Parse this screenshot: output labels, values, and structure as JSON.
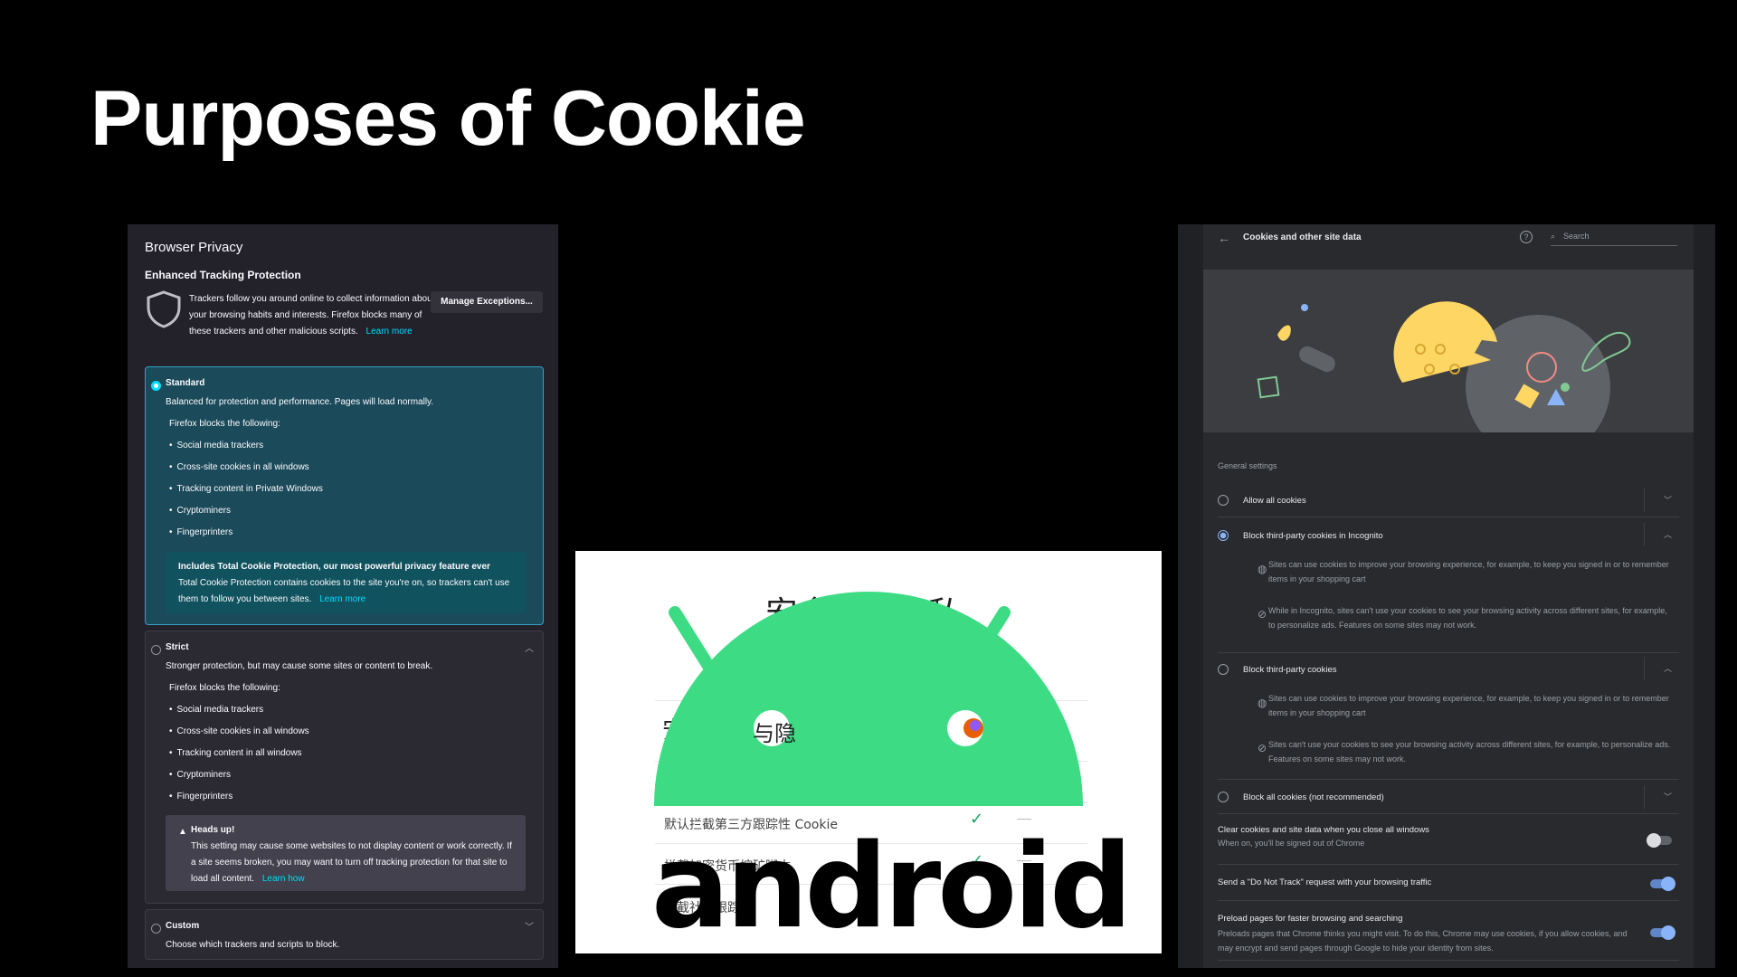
{
  "slide": {
    "title": "Purposes of Cookie"
  },
  "firefox": {
    "header": "Browser Privacy",
    "section": "Enhanced Tracking Protection",
    "intro": "Trackers follow you around online to collect information about your browsing habits and interests. Firefox blocks many of these trackers and other malicious scripts.",
    "learn_more": "Learn more",
    "manage_button": "Manage Exceptions...",
    "standard": {
      "title": "Standard",
      "desc": "Balanced for protection and performance. Pages will load normally.",
      "blocks_heading": "Firefox blocks the following:",
      "items": [
        "Social media trackers",
        "Cross-site cookies in all windows",
        "Tracking content in Private Windows",
        "Cryptominers",
        "Fingerprinters"
      ],
      "note_title": "Includes Total Cookie Protection, our most powerful privacy feature ever",
      "note_body": "Total Cookie Protection contains cookies to the site you're on, so trackers can't use them to follow you between sites.",
      "note_link": "Learn more"
    },
    "strict": {
      "title": "Strict",
      "desc": "Stronger protection, but may cause some sites or content to break.",
      "blocks_heading": "Firefox blocks the following:",
      "items": [
        "Social media trackers",
        "Cross-site cookies in all windows",
        "Tracking content in all windows",
        "Cryptominers",
        "Fingerprinters"
      ],
      "note_title": "Heads up!",
      "note_body": "This setting may cause some websites to not display content or work correctly. If a site seems broken, you may want to turn off tracking protection for that site to load all content.",
      "note_link": "Learn how"
    },
    "custom": {
      "title": "Custom",
      "desc": "Choose which trackers and scripts to block."
    }
  },
  "android": {
    "cn_title": "安全性与隐私",
    "cn_head_left": "安",
    "cn_head_mid": "与隐",
    "rows": [
      "默认拦截第三方跟踪性 Cookie",
      "拦截加密货币挖矿脚本",
      "拦截社交跟踪器"
    ],
    "logo_word": "android",
    "brand_green": "#3ddc84"
  },
  "chrome": {
    "title": "Cookies and other site data",
    "help_glyph": "?",
    "search_placeholder": "Search",
    "section": "General settings",
    "options": {
      "allow_all": "Allow all cookies",
      "block_incognito": "Block third-party cookies in Incognito",
      "block_third": "Block third-party cookies",
      "block_all": "Block all cookies (not recommended)"
    },
    "incognito_details": [
      "Sites can use cookies to improve your browsing experience, for example, to keep you signed in or to remember items in your shopping cart",
      "While in Incognito, sites can't use your cookies to see your browsing activity across different sites, for example, to personalize ads. Features on some sites may not work."
    ],
    "third_details": [
      "Sites can use cookies to improve your browsing experience, for example, to keep you signed in or to remember items in your shopping cart",
      "Sites can't use your cookies to see your browsing activity across different sites, for example, to personalize ads. Features on some sites may not work."
    ],
    "toggles": {
      "clear": {
        "label": "Clear cookies and site data when you close all windows",
        "desc": "When on, you'll be signed out of Chrome",
        "state": "off"
      },
      "dnt": {
        "label": "Send a \"Do Not Track\" request with your browsing traffic",
        "state": "on"
      },
      "preload": {
        "label": "Preload pages for faster browsing and searching",
        "desc": "Preloads pages that Chrome thinks you might visit. To do this, Chrome may use cookies, if you allow cookies, and may encrypt and send pages through Google to hide your identity from sites.",
        "state": "on"
      }
    },
    "accent": "#8ab4f8"
  }
}
